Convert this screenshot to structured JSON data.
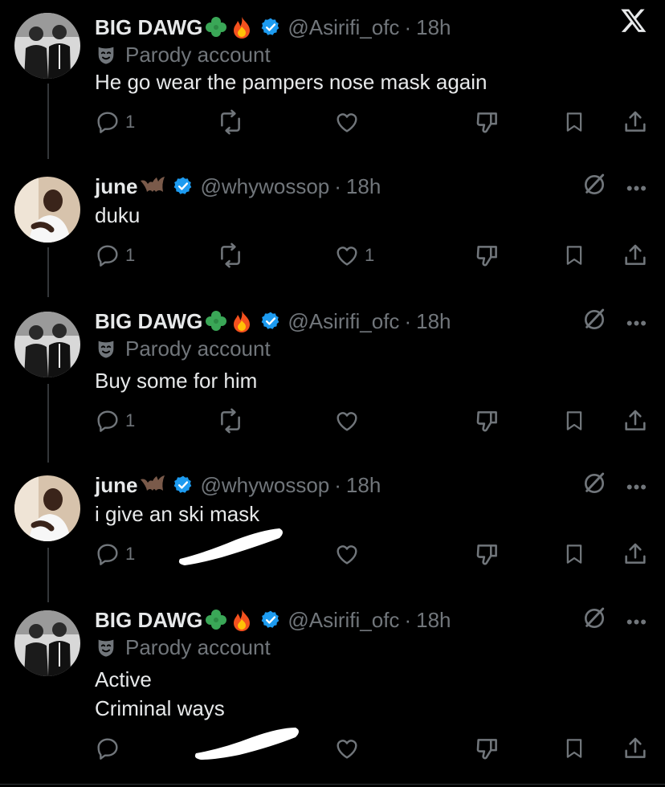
{
  "tweets": [
    {
      "display_name": "BIG DAWG",
      "handle": "@Asirifi_ofc",
      "time": "18h",
      "parody_label": "Parody account",
      "text": [
        "He go wear the pampers nose mask again"
      ],
      "reply_count": "1",
      "like_count": ""
    },
    {
      "display_name": "june",
      "handle": "@whywossop",
      "time": "18h",
      "text": [
        "duku"
      ],
      "reply_count": "1",
      "like_count": "1"
    },
    {
      "display_name": "BIG DAWG",
      "handle": "@Asirifi_ofc",
      "time": "18h",
      "parody_label": "Parody account",
      "text": [
        "Buy some for him"
      ],
      "reply_count": "1",
      "like_count": ""
    },
    {
      "display_name": "june",
      "handle": "@whywossop",
      "time": "18h",
      "text": [
        "i give an ski mask"
      ],
      "reply_count": "1",
      "like_count": ""
    },
    {
      "display_name": "BIG DAWG",
      "handle": "@Asirifi_ofc",
      "time": "18h",
      "parody_label": "Parody account",
      "text": [
        "Active",
        "Criminal ways"
      ],
      "reply_count": "",
      "like_count": ""
    }
  ],
  "sep": "·",
  "colors": {
    "background": "#000000",
    "text": "#e7e9ea",
    "muted": "#71767b",
    "verified": "#1d9bf0"
  },
  "icons": [
    "x-logo-icon",
    "reply-icon",
    "retweet-icon",
    "like-icon",
    "dislike-icon",
    "bookmark-icon",
    "share-icon",
    "grok-icon",
    "more-icon",
    "verified-icon",
    "shamrock-emoji",
    "fire-emoji",
    "bat-emoji",
    "parody-mask-icon"
  ]
}
